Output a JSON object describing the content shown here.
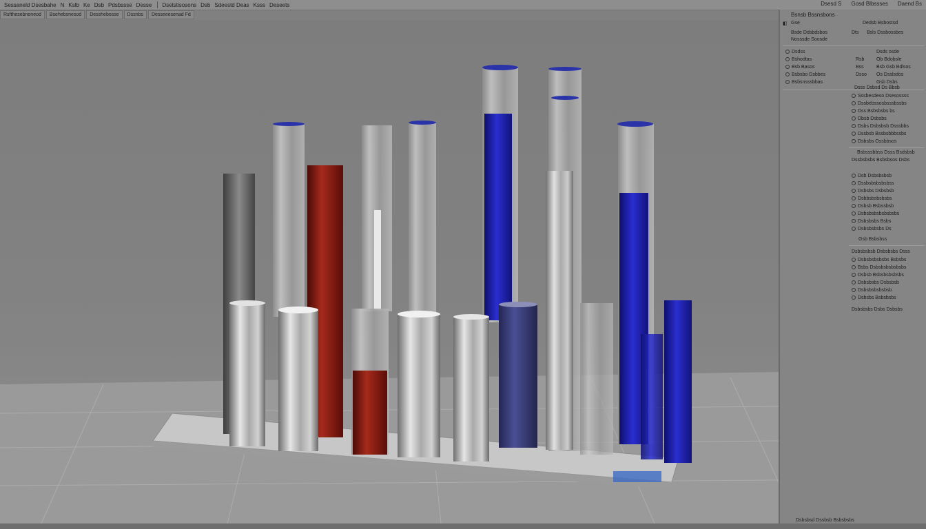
{
  "menubar": {
    "items": [
      "Sessaneld Dsesbahe",
      "N",
      "Kslb",
      "Ke",
      "Dsb",
      "Pdsbssse",
      "Desse"
    ],
    "items2": [
      "Dsetstisosons",
      "Dsb",
      "Sdeestd Deas",
      "Ksss",
      "Deseets"
    ],
    "right": [
      "Dsesd S",
      "Gosd Blbssses",
      "Daend Bs"
    ]
  },
  "tabs": [
    "Rsfthesebnoneod",
    "Bsehebsnesod",
    "Desshebosse",
    "Dssnbs",
    "Desseeesenad  Fd"
  ],
  "panel": {
    "title": "Bsnsb Bssnsbons",
    "header_left": "Gse",
    "header_right": "Dedsb Bsbostsd",
    "sub_left": "Bsde Ddsbdsbos",
    "sub_mid": "Dts",
    "sub_right": "Bsls Dssbossbes",
    "sub_row2": "Nosssde Soosde",
    "props": [
      {
        "label": "Dsdss",
        "mid": "",
        "value": "Dsds osde"
      },
      {
        "label": "Bshodtas",
        "mid": "Rsb",
        "value": "Ob Bdobsle"
      },
      {
        "label": "Bsb Basos",
        "mid": "Bss",
        "value": "Bsb Gsb Bdlsos"
      },
      {
        "label": "Bsbsbo Dsbbes",
        "mid": "Dsso",
        "value": "Os Dsslsdos"
      },
      {
        "label": "Bsbsnsssbbas",
        "mid": "",
        "value": "Gsb Dsbs"
      }
    ],
    "section1_title": "Dsss Dsbsd Ds Bbsb",
    "section1": [
      "Sssbesdeso Dsesossss",
      "Dssbebssosbsssbssbs",
      "Dss Bsbsbsbs bs",
      "Dbsb Dsbsbs",
      "Dsbs Dsbsbsb Dsssbbs",
      "Dssbsb Bssbsbbbssbs",
      "Dsbsbs Ossbbsos"
    ],
    "section2_title": "Bsbsssbbss Dsss Bsdsbsb",
    "section2_sub": "Dssbsbsbs Bsbsbsos Dsbs",
    "section2": [
      "Dsb Dsbsbsbsb",
      "Dssbsbsbsbsbss",
      "Dsbsbs Dsbsbsb",
      "Dsbbsbsbsbsbs",
      "Dsbsb Bsbssbsb",
      "Dsbsbsbsbsbsbsbs",
      "Dsbsbsbs Bsbs",
      "Dsbsbsbsbs Ds"
    ],
    "section2_footer": "Gsb Bsbsbss",
    "section3_title": "Dsbsbsbsb Dsbsbsbs Dsss",
    "section3": [
      "Dsbsbsbsbsbs Bsbsbs",
      "Bsbs Dsbsbsbsbsbsbs",
      "Dsbsb Bsbsbsbsbsbs",
      "Dsbsbsbs Dsbsbsb",
      "Dsbsbsbsbsbsb",
      "Dsbsbs Bsbsbsbs"
    ],
    "section3_footer": "Dsbsbsbs Dsbs Dsbsbs"
  },
  "status": "Dsbsbsd Dssbsb Bsbsbsbs",
  "colors": {
    "silver": "#b8b8b8",
    "red": "#8e1a12",
    "blue": "#1f20b8",
    "navy": "#3a3e78"
  }
}
